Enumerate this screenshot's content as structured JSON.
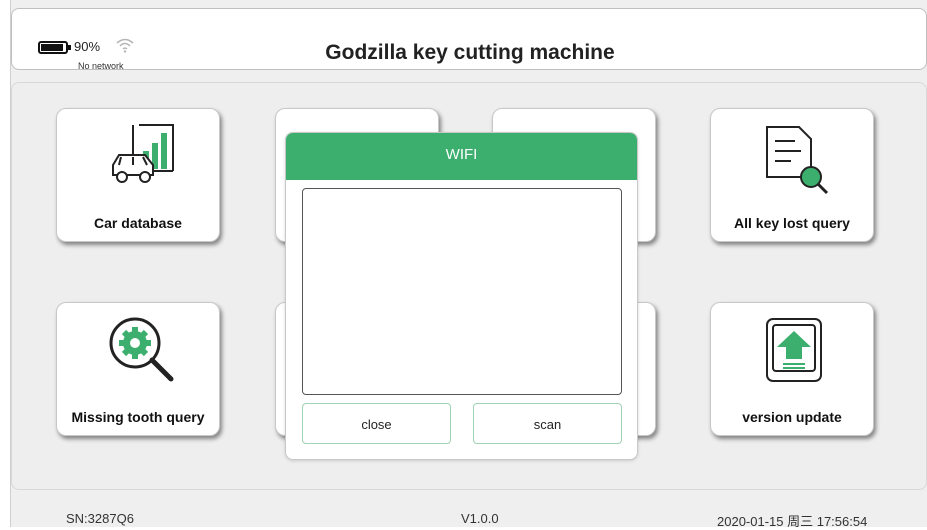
{
  "status": {
    "battery_percent": "90%",
    "network_status": "No network",
    "icons": [
      "battery-icon",
      "wifi-icon"
    ]
  },
  "header": {
    "title": "Godzilla key cutting machine"
  },
  "tiles": [
    {
      "label": "Car database",
      "icon": "car-chart-icon"
    },
    {
      "label": "All key lost query",
      "icon": "document-search-icon"
    },
    {
      "label": "Missing tooth query",
      "icon": "gear-search-icon"
    },
    {
      "label": "version update",
      "icon": "upload-arrow-icon"
    }
  ],
  "dialog": {
    "title": "WIFI",
    "close_label": "close",
    "scan_label": "scan"
  },
  "footer": {
    "serial": "SN:3287Q6",
    "version": "V1.0.0",
    "datetime": "2020-01-15 周三 17:56:54"
  },
  "colors": {
    "accent": "#3caf6e",
    "icon_dark": "#222222"
  }
}
